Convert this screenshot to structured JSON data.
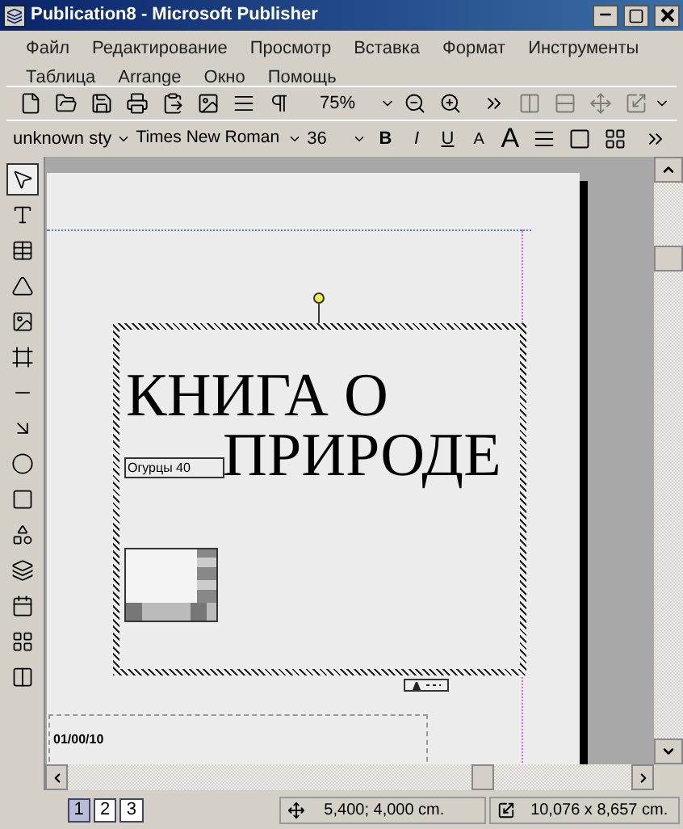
{
  "window": {
    "title": "Publication8 - Microsoft Publisher"
  },
  "menu": [
    "Файл",
    "Редактирование",
    "Просмотр",
    "Вставка",
    "Формат",
    "Инструменты",
    "Таблица",
    "Arrange",
    "Окно",
    "Помощь"
  ],
  "toolbar_standard": {
    "zoom": "75%"
  },
  "toolbar_formatting": {
    "style": "unknown sty",
    "font": "Times New Roman",
    "size": "36",
    "format_buttons": [
      "B",
      "I",
      "U"
    ],
    "size_buttons": [
      "A",
      "A"
    ]
  },
  "page": {
    "title_lines": [
      "КНИГА О",
      "ПРИРОДЕ"
    ],
    "small_text": "Огурцы 40",
    "date": "01/00/10"
  },
  "page_tabs": [
    {
      "label": "1",
      "selected": true
    },
    {
      "label": "2",
      "selected": false
    },
    {
      "label": "3",
      "selected": false
    }
  ],
  "status_bar": {
    "position": "5,400; 4,000 cm.",
    "size": "10,076 x 8,657 cm."
  }
}
